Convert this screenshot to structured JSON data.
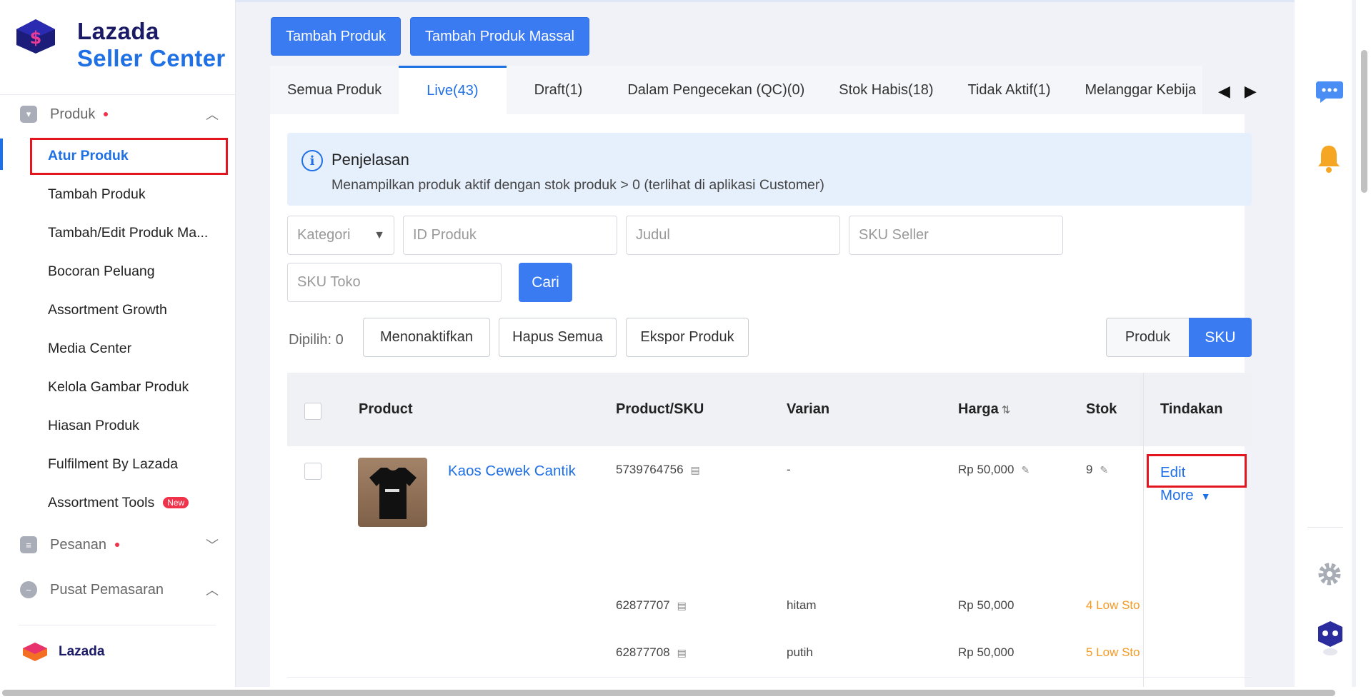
{
  "brand": {
    "line1": "Lazada",
    "line2": "Seller Center",
    "bottom": "Lazada"
  },
  "sidebar": {
    "sections": [
      {
        "label": "Produk",
        "expanded": true
      },
      {
        "label": "Pesanan",
        "expanded": false
      },
      {
        "label": "Pusat Pemasaran",
        "expanded": true
      }
    ],
    "items": [
      {
        "label": "Atur Produk"
      },
      {
        "label": "Tambah Produk"
      },
      {
        "label": "Tambah/Edit Produk Ma..."
      },
      {
        "label": "Bocoran Peluang"
      },
      {
        "label": "Assortment Growth"
      },
      {
        "label": "Media Center"
      },
      {
        "label": "Kelola Gambar Produk"
      },
      {
        "label": "Hiasan Produk"
      },
      {
        "label": "Fulfilment By Lazada"
      },
      {
        "label": "Assortment Tools",
        "badge": "New"
      }
    ]
  },
  "top_buttons": {
    "add": "Tambah Produk",
    "bulk": "Tambah Produk Massal"
  },
  "tabs": [
    {
      "label": "Semua Produk"
    },
    {
      "label": "Live(43)"
    },
    {
      "label": "Draft(1)"
    },
    {
      "label": "Dalam Pengecekan (QC)(0)"
    },
    {
      "label": "Stok Habis(18)"
    },
    {
      "label": "Tidak Aktif(1)"
    },
    {
      "label": "Melanggar Kebija"
    }
  ],
  "info": {
    "title": "Penjelasan",
    "desc": "Menampilkan produk aktif dengan stok produk > 0 (terlihat di aplikasi Customer)"
  },
  "filters": {
    "kategori": "Kategori",
    "id_produk": "ID Produk",
    "judul": "Judul",
    "sku_seller": "SKU Seller",
    "sku_toko": "SKU Toko",
    "search_btn": "Cari"
  },
  "actions": {
    "selected": "Dipilih: 0",
    "deactivate": "Menonaktifkan",
    "delete_all": "Hapus Semua",
    "export": "Ekspor Produk",
    "view_product": "Produk",
    "view_sku": "SKU"
  },
  "table": {
    "headers": {
      "product": "Product",
      "product_sku": "Product/SKU",
      "varian": "Varian",
      "harga": "Harga",
      "stok": "Stok",
      "tindakan": "Tindakan"
    },
    "product": {
      "name": "Kaos Cewek Cantik",
      "id": "5739764756",
      "varian": "-",
      "harga": "Rp 50,000",
      "stok": "9",
      "edit": "Edit",
      "more": "More"
    },
    "skus": [
      {
        "sku": "62877707",
        "varian": "hitam",
        "harga": "Rp 50,000",
        "stok": "4  Low Sto"
      },
      {
        "sku": "62877708",
        "varian": "putih",
        "harga": "Rp 50,000",
        "stok": "5  Low Sto"
      }
    ]
  },
  "colors": {
    "primary": "#3b7bf2",
    "link": "#1f6fe5",
    "warning": "#f59a23",
    "highlight": "#e3151e"
  }
}
